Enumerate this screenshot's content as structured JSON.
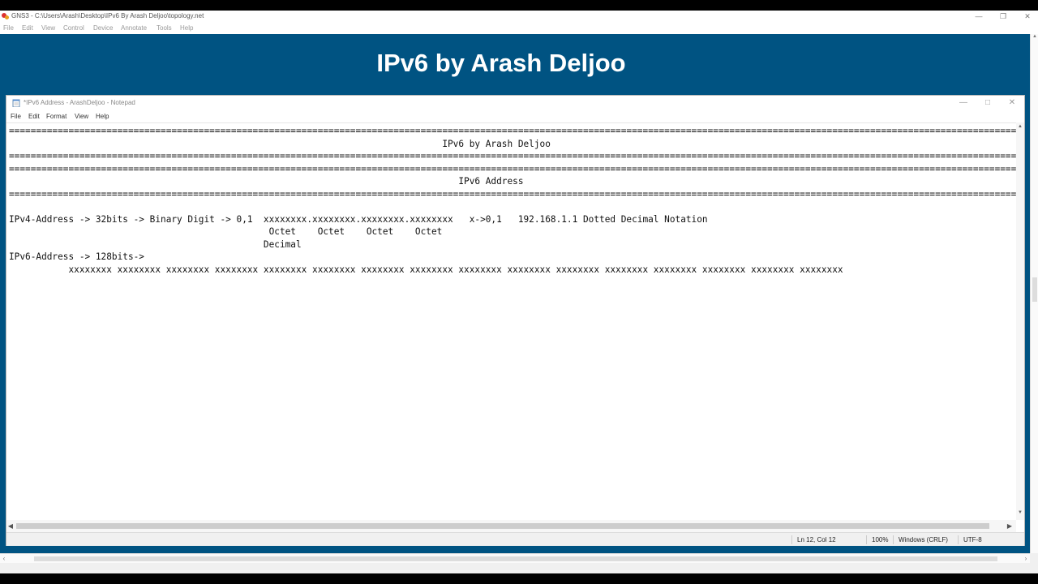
{
  "gns": {
    "title": "GNS3 - C:\\Users\\Arash\\Desktop\\IPv6 By Arash Deljoo\\topology.net",
    "menu": [
      "File",
      "Edit",
      "View",
      "Control",
      "Device",
      "Annotate",
      "Tools",
      "Help"
    ],
    "banner": "IPv6 by Arash Deljoo"
  },
  "notepad": {
    "title": "*IPv6 Address - ArashDeljoo - Notepad",
    "menu": [
      "File",
      "Edit",
      "Format",
      "View",
      "Help"
    ],
    "lines": [
      "=========================================================================================================================================================================================================",
      "                                                                                IPv6 by Arash Deljoo",
      "=========================================================================================================================================================================================================",
      "=========================================================================================================================================================================================================",
      "                                                                                   IPv6 Address",
      "=========================================================================================================================================================================================================",
      "",
      "IPv4-Address -> 32bits -> Binary Digit -> 0,1  xxxxxxxx.xxxxxxxx.xxxxxxxx.xxxxxxxx   x->0,1   192.168.1.1 Dotted Decimal Notation",
      "                                                Octet    Octet    Octet    Octet",
      "                                               Decimal",
      "IPv6-Address -> 128bits->",
      "           xxxxxxxx xxxxxxxx xxxxxxxx xxxxxxxx xxxxxxxx xxxxxxxx xxxxxxxx xxxxxxxx xxxxxxxx xxxxxxxx xxxxxxxx xxxxxxxx xxxxxxxx xxxxxxxx xxxxxxxx xxxxxxxx"
    ],
    "status": {
      "position": "Ln 12, Col 12",
      "zoom": "100%",
      "line_ending": "Windows (CRLF)",
      "encoding": "UTF-8"
    }
  }
}
